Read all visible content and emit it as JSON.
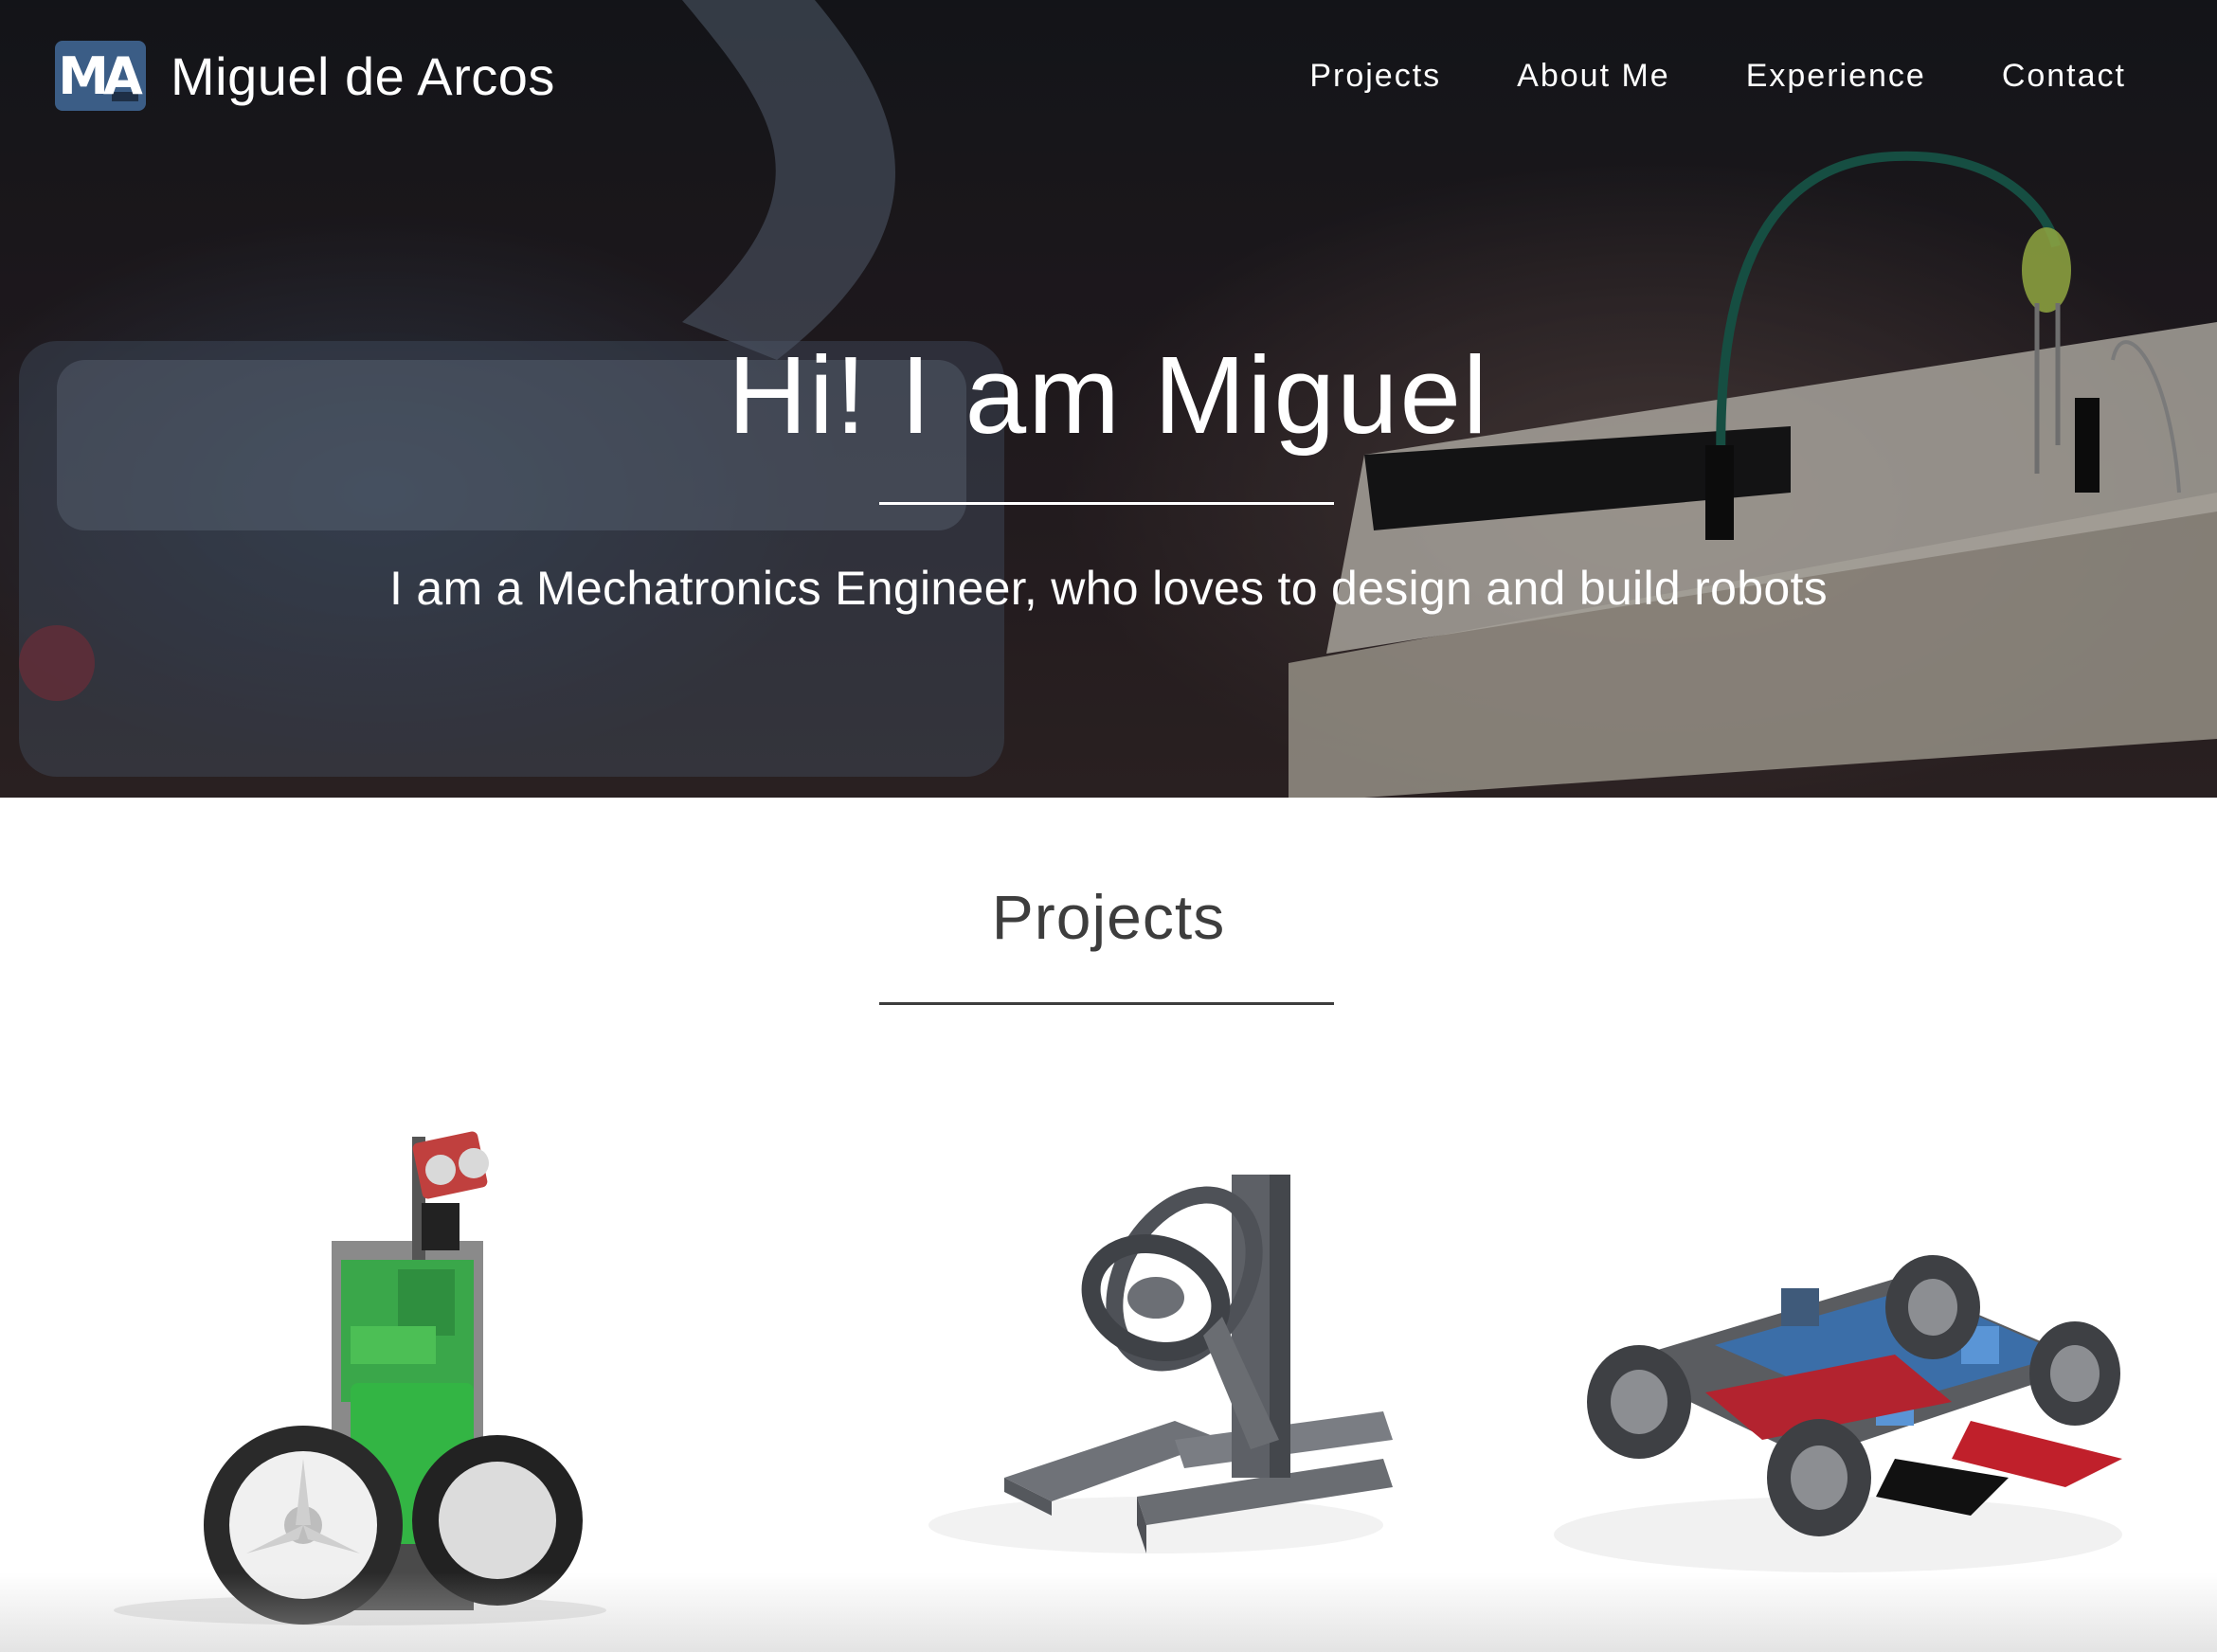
{
  "nav": {
    "logo_text": "MA",
    "brand": "Miguel de Arcos",
    "links": [
      {
        "label": "Projects"
      },
      {
        "label": "About Me"
      },
      {
        "label": "Experience"
      },
      {
        "label": "Contact"
      }
    ]
  },
  "hero": {
    "title": "Hi! I am Miguel",
    "subtitle": "I am a Mechatronics Engineer, who loves to design and build robots"
  },
  "projects": {
    "title": "Projects",
    "items": [
      {
        "icon": "balancing-robot-image"
      },
      {
        "icon": "gimbal-mount-image"
      },
      {
        "icon": "rover-robot-image"
      }
    ]
  },
  "colors": {
    "logo_bg": "#3b5d86",
    "text_dark": "#3d3d3d",
    "hero_text": "#ffffff"
  }
}
